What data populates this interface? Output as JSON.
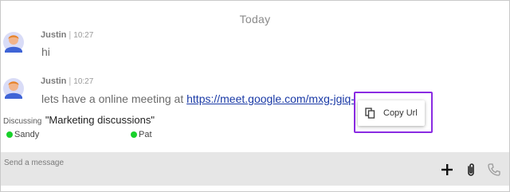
{
  "day_separator": "Today",
  "messages": [
    {
      "author": "Justin",
      "separator": "|",
      "time": "10:27",
      "text": "hi"
    },
    {
      "author": "Justin",
      "separator": "|",
      "time": "10:27",
      "text": "lets have a online meeting at ",
      "link": "https://meet.google.com/mxg-jgiq-cws"
    }
  ],
  "discussion": {
    "label": "Discussing",
    "title": "\"Marketing discussions\""
  },
  "members": [
    {
      "name": "Sandy",
      "status_color": "#19d12b"
    },
    {
      "name": "Pat",
      "status_color": "#19d12b"
    }
  ],
  "context_menu": {
    "icon": "copy-icon",
    "label": "Copy Url"
  },
  "composer": {
    "placeholder": "Send a message",
    "actions": [
      "plus-icon",
      "paperclip-icon",
      "phone-icon"
    ]
  }
}
